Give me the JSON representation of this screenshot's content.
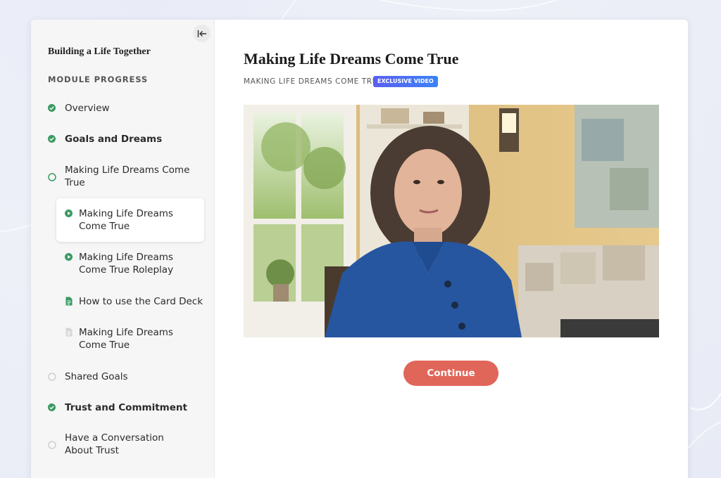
{
  "sidebar": {
    "course_title": "Building a Life Together",
    "module_label": "MODULE PROGRESS",
    "items": [
      {
        "label": "Overview",
        "status": "complete"
      },
      {
        "label": "Goals and Dreams",
        "status": "complete"
      },
      {
        "label": "Making Life Dreams Come True",
        "status": "in-progress"
      },
      {
        "label": "Making Life Dreams Come True",
        "status": "video-current"
      },
      {
        "label": "Making Life Dreams Come True Roleplay",
        "status": "video"
      },
      {
        "label": "How to use the Card Deck",
        "status": "document"
      },
      {
        "label": "Making Life Dreams Come True",
        "status": "document-unread"
      },
      {
        "label": "Shared Goals",
        "status": "not-started"
      },
      {
        "label": "Trust and Commitment",
        "status": "complete"
      },
      {
        "label": "Have a Conversation About Trust",
        "status": "not-started"
      }
    ]
  },
  "main": {
    "title": "Making Life Dreams Come True",
    "subtitle": "MAKING LIFE DREAMS COME TRUE",
    "badge": "EXCLUSIVE VIDEO",
    "continue_label": "Continue"
  },
  "colors": {
    "accent_green": "#3a9a62",
    "continue_button": "#e0665a",
    "badge_start": "#5b5ff0",
    "badge_end": "#3b82f6"
  },
  "icons": {
    "collapse": "collapse-sidebar-icon",
    "complete": "check-circle-icon",
    "in_progress": "circle-outline-icon",
    "video": "play-circle-icon",
    "document": "document-icon"
  }
}
